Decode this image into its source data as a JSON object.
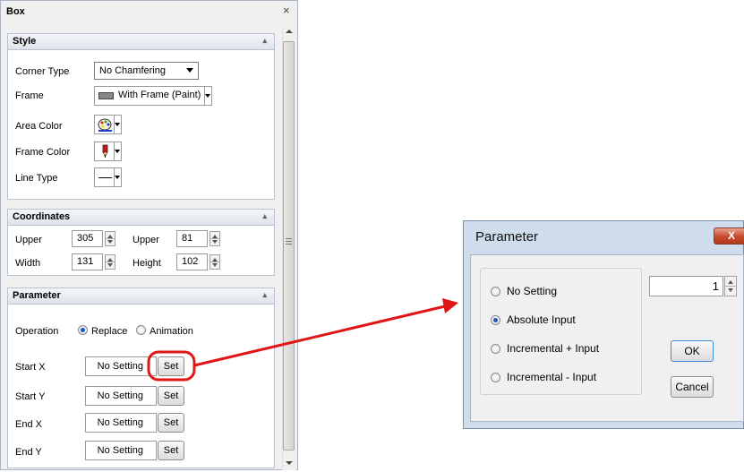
{
  "panel": {
    "title": "Box",
    "close": "×",
    "style": {
      "header": "Style",
      "corner_type_label": "Corner Type",
      "corner_type_value": "No Chamfering",
      "frame_label": "Frame",
      "frame_value": "With Frame (Paint)",
      "area_color_label": "Area Color",
      "frame_color_label": "Frame Color",
      "line_type_label": "Line Type"
    },
    "coordinates": {
      "header": "Coordinates",
      "upper1_label": "Upper",
      "upper1_value": "305",
      "upper2_label": "Upper",
      "upper2_value": "81",
      "width_label": "Width",
      "width_value": "131",
      "height_label": "Height",
      "height_value": "102"
    },
    "parameter": {
      "header": "Parameter",
      "operation_label": "Operation",
      "replace_label": "Replace",
      "animation_label": "Animation",
      "rows": [
        {
          "label": "Start X",
          "value": "No Setting",
          "button": "Set"
        },
        {
          "label": "Start Y",
          "value": "No Setting",
          "button": "Set"
        },
        {
          "label": "End X",
          "value": "No Setting",
          "button": "Set"
        },
        {
          "label": "End Y",
          "value": "No Setting",
          "button": "Set"
        }
      ]
    }
  },
  "dialog": {
    "title": "Parameter",
    "close": "X",
    "options": [
      "No Setting",
      "Absolute Input",
      "Incremental + Input",
      "Incremental - Input"
    ],
    "selected_option": "Absolute Input",
    "number_value": "1",
    "ok_label": "OK",
    "cancel_label": "Cancel"
  },
  "colors": {
    "annotation_red": "#e01515",
    "radio_selected": "#1a57c9",
    "dialog_frame": "#cfdcec"
  }
}
